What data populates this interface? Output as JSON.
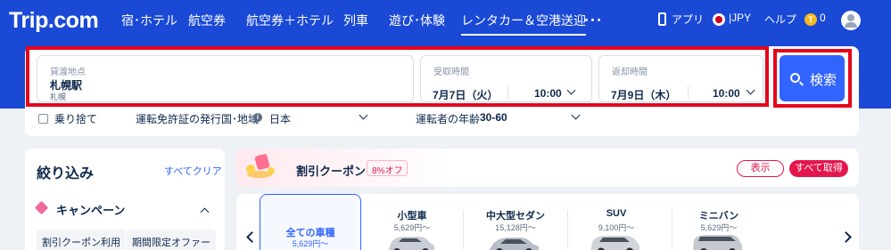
{
  "header": {
    "logo": "Trip.com",
    "nav": [
      {
        "label": "宿･ホテル"
      },
      {
        "label": "航空券"
      },
      {
        "label": "航空券＋ホテル"
      },
      {
        "label": "列車"
      },
      {
        "label": "遊び･体験"
      },
      {
        "label": "レンタカー＆空港送迎",
        "active": true
      },
      {
        "label": "･･･"
      }
    ],
    "app_label": "アプリ",
    "currency": "JPY",
    "help": "ヘルプ",
    "coins": "0"
  },
  "search": {
    "pickup": {
      "label": "貸渡地点",
      "value": "札幌駅",
      "sub": "札幌"
    },
    "pickup_time": {
      "label": "受取時間",
      "date": "7月7日（火）",
      "time": "10:00"
    },
    "return_time": {
      "label": "返却時間",
      "date": "7月9日（木）",
      "time": "10:00"
    },
    "button": "検索",
    "one_way": "乗り捨て",
    "license_label": "運転免許証の発行国･地域",
    "license_value": "日本",
    "age_label": "運転者の年齢",
    "age_value": "30-60"
  },
  "filter": {
    "title": "絞り込み",
    "clear": "すべてクリア",
    "campaign": "キャンペーン",
    "tags": [
      "割引クーポン利用",
      "期間限定オファー"
    ]
  },
  "coupon": {
    "title": "割引クーポン",
    "badge": "8%オフ",
    "show": "表示",
    "get_all": "すべて取得"
  },
  "car_types": [
    {
      "name": "全ての車種",
      "price": "5,629円～",
      "selected": true
    },
    {
      "name": "小型車",
      "price": "5,629円～"
    },
    {
      "name": "中大型セダン",
      "price": "15,128円～"
    },
    {
      "name": "SUV",
      "price": "9,100円～"
    },
    {
      "name": "ミニバン",
      "price": "5,629円～"
    }
  ],
  "colors": {
    "brand": "#1a49d6",
    "accent": "#3264ff",
    "highlight": "#e3061c",
    "coupon": "#e3174d"
  }
}
